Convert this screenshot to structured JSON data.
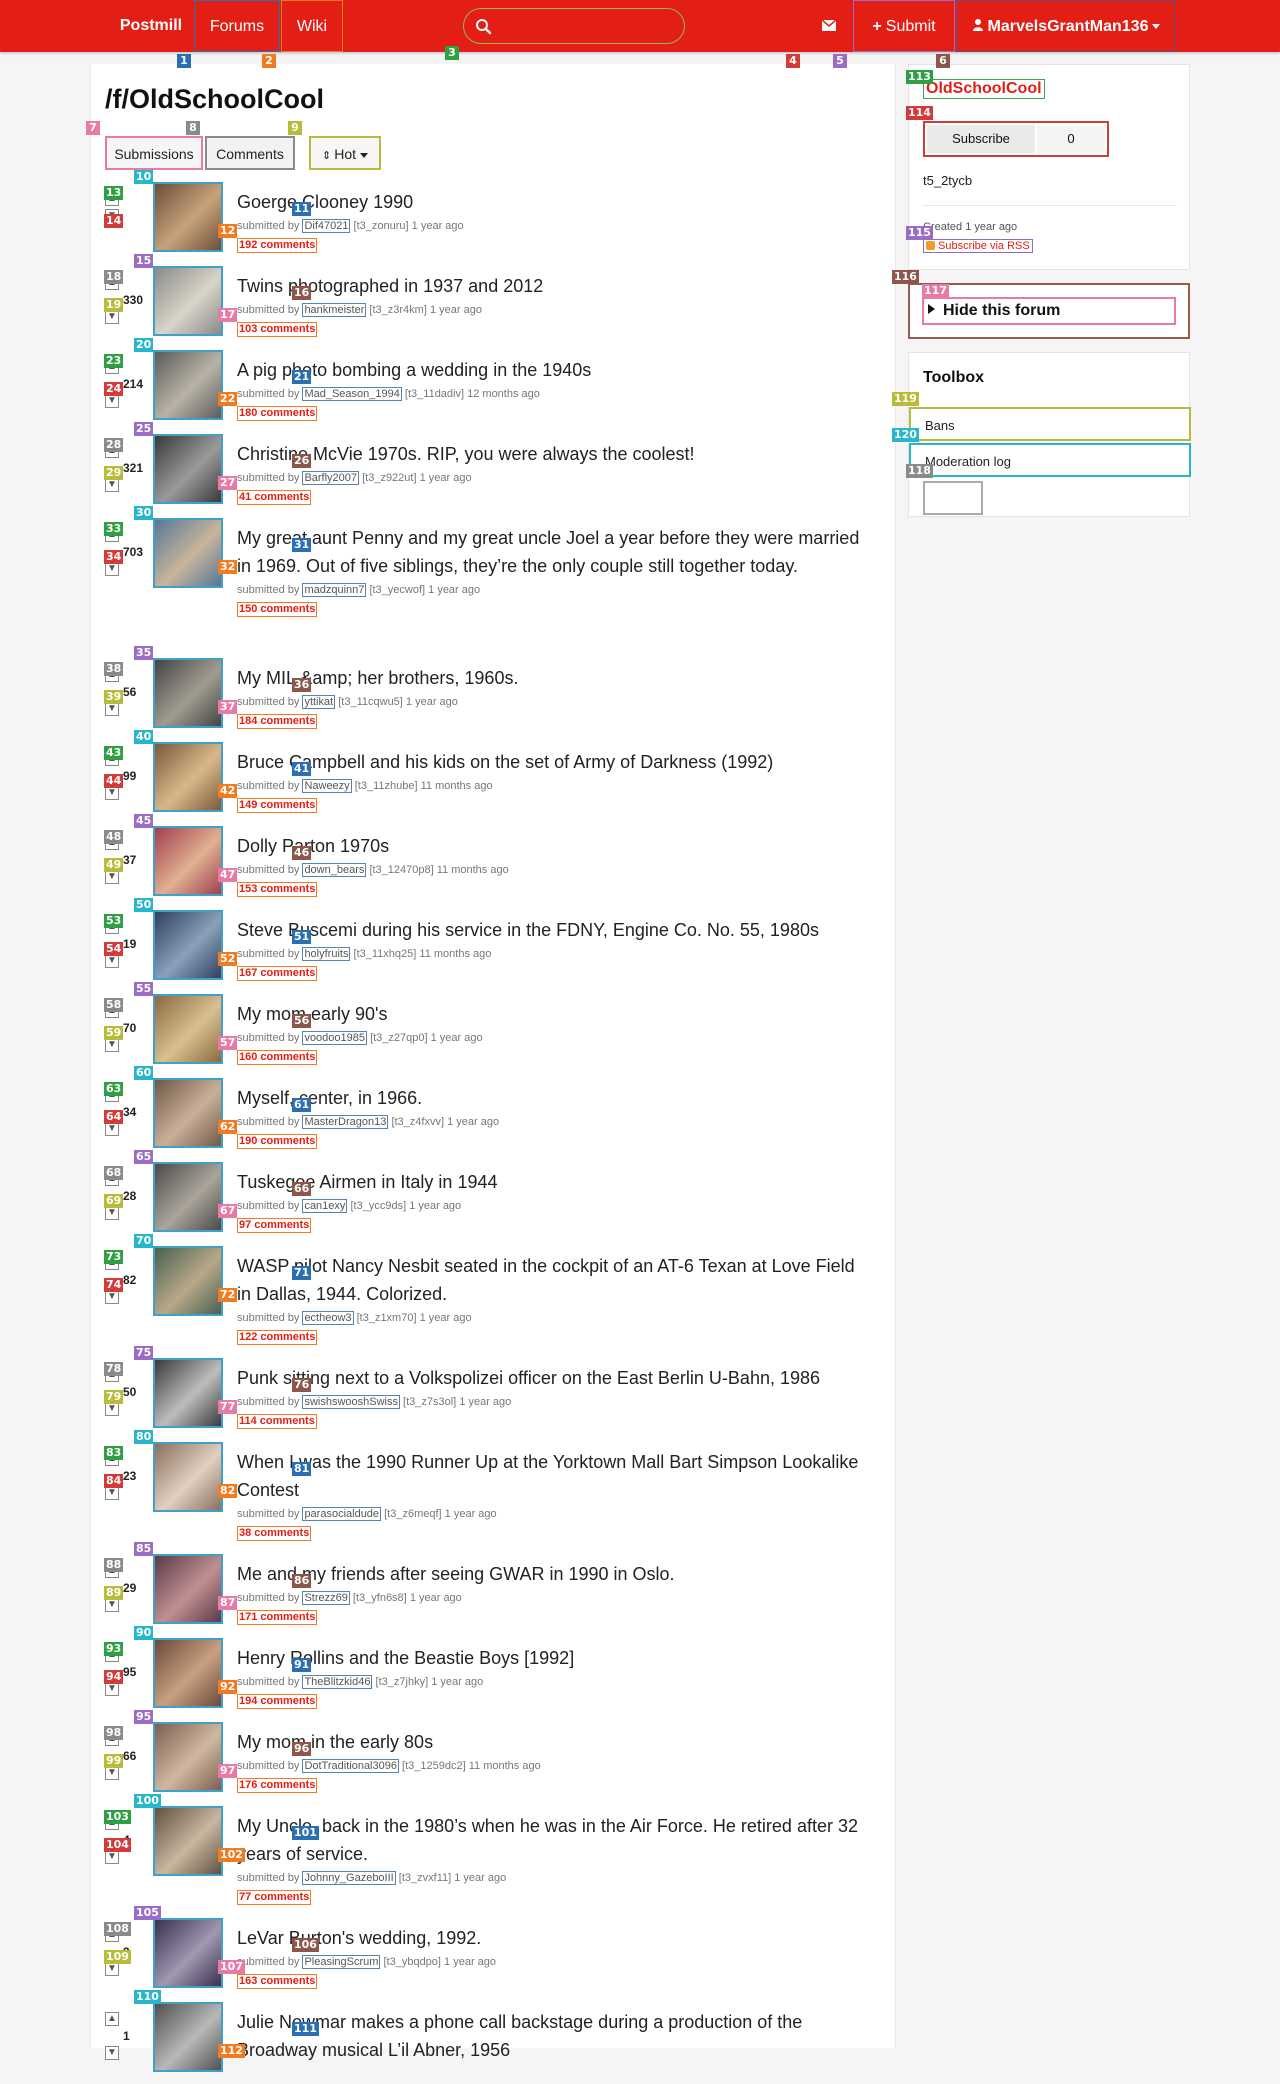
{
  "nav": {
    "brand": "Postmill",
    "forums": "Forums",
    "wiki": "Wiki",
    "submit": "Submit",
    "user": "MarvelsGrantMan136"
  },
  "search": {
    "placeholder": ""
  },
  "forum": {
    "title": "/f/OldSchoolCool",
    "tabs": [
      "Submissions",
      "Comments"
    ],
    "sort": "Hot"
  },
  "submissions": [
    {
      "score": "",
      "title": "Goerge Clooney 1990",
      "author": "Dif47021",
      "id": "[t3_zonuru]",
      "age": "1 year ago",
      "comments": "192 comments"
    },
    {
      "score": "330",
      "title": "Twins photographed in 1937 and 2012",
      "author": "hankmeister",
      "id": "[t3_z3r4km]",
      "age": "1 year ago",
      "comments": "103 comments"
    },
    {
      "score": "214",
      "title": "A pig photo bombing a wedding in the 1940s",
      "author": "Mad_Season_1994",
      "id": "[t3_11dadiv]",
      "age": "12 months ago",
      "comments": "180 comments"
    },
    {
      "score": "321",
      "title": "Christine McVie 1970s. RIP, you were always the coolest!",
      "author": "Barfly2007",
      "id": "[t3_z922ut]",
      "age": "1 year ago",
      "comments": "41 comments"
    },
    {
      "score": "703",
      "title": "My great aunt Penny and my great uncle Joel a year before they were married in 1969. Out of five siblings, they’re the only couple still together today.",
      "author": "madzquinn7",
      "id": "[t3_yecwof]",
      "age": "1 year ago",
      "comments": "150 comments"
    },
    {
      "score": "56",
      "title": "My MIL &amp; her brothers, 1960s.",
      "author": "yttikat",
      "id": "[t3_11cqwu5]",
      "age": "1 year ago",
      "comments": "184 comments"
    },
    {
      "score": "99",
      "title": "Bruce Campbell and his kids on the set of Army of Darkness (1992)",
      "author": "Naweezy",
      "id": "[t3_11zhube]",
      "age": "11 months ago",
      "comments": "149 comments"
    },
    {
      "score": "37",
      "title": "Dolly Parton 1970s",
      "author": "down_bears",
      "id": "[t3_12470p8]",
      "age": "11 months ago",
      "comments": "153 comments"
    },
    {
      "score": "19",
      "title": "Steve Buscemi during his service in the FDNY, Engine Co. No. 55, 1980s",
      "author": "holyfruits",
      "id": "[t3_11xhq25]",
      "age": "11 months ago",
      "comments": "167 comments"
    },
    {
      "score": "70",
      "title": "My mom early 90's",
      "author": "voodoo1985",
      "id": "[t3_z27qp0]",
      "age": "1 year ago",
      "comments": "160 comments"
    },
    {
      "score": "34",
      "title": "Myself, center, in 1966.",
      "author": "MasterDragon13",
      "id": "[t3_z4fxvv]",
      "age": "1 year ago",
      "comments": "190 comments"
    },
    {
      "score": "28",
      "title": "Tuskegee Airmen in Italy in 1944",
      "author": "can1exy",
      "id": "[t3_ycc9ds]",
      "age": "1 year ago",
      "comments": "97 comments"
    },
    {
      "score": "82",
      "title": "WASP pilot Nancy Nesbit seated in the cockpit of an AT-6 Texan at Love Field in Dallas, 1944. Colorized.",
      "author": "ectheow3",
      "id": "[t3_z1xm70]",
      "age": "1 year ago",
      "comments": "122 comments"
    },
    {
      "score": "50",
      "title": "Punk sitting next to a Volkspolizei officer on the East Berlin U-Bahn, 1986",
      "author": "swishswooshSwiss",
      "id": "[t3_z7s3ol]",
      "age": "1 year ago",
      "comments": "114 comments"
    },
    {
      "score": "23",
      "title": "When I was the 1990 Runner Up at the Yorktown Mall Bart Simpson Lookalike Contest",
      "author": "parasocialdude",
      "id": "[t3_z6meqf]",
      "age": "1 year ago",
      "comments": "38 comments"
    },
    {
      "score": "29",
      "title": "Me and my friends after seeing GWAR in 1990 in Oslo.",
      "author": "Strezz69",
      "id": "[t3_yfn6s8]",
      "age": "1 year ago",
      "comments": "171 comments"
    },
    {
      "score": "95",
      "title": "Henry Rollins and the Beastie Boys [1992]",
      "author": "TheBlitzkid46",
      "id": "[t3_z7jhky]",
      "age": "1 year ago",
      "comments": "194 comments"
    },
    {
      "score": "66",
      "title": "My mom in the early 80s",
      "author": "DotTraditional3096",
      "id": "[t3_1259dc2]",
      "age": "11 months ago",
      "comments": "176 comments"
    },
    {
      "score": "4",
      "title": "My Uncle, back in the 1980’s when he was in the Air Force. He retired after 32 years of service.",
      "author": "Johnny_GazeboIII",
      "id": "[t3_zvxf11]",
      "age": "1 year ago",
      "comments": "77 comments"
    },
    {
      "score": "3",
      "title": "LeVar Burton's wedding, 1992.",
      "author": "PleasingScrum",
      "id": "[t3_ybqdpo]",
      "age": "1 year ago",
      "comments": "163 comments"
    },
    {
      "score": "1",
      "title": "Julie Newmar makes a phone call backstage during a production of the Broadway musical L’il Abner, 1956",
      "author": "",
      "id": "",
      "age": "",
      "comments": ""
    }
  ],
  "meta_labels": {
    "submitted_by": "submitted by"
  },
  "sidebar": {
    "forum_name": "OldSchoolCool",
    "subscribe": "Subscribe",
    "subscriber_count": "0",
    "forum_id": "t5_2tycb",
    "created": "Created 1 year ago",
    "rss": "Subscribe via RSS",
    "hide_forum": "Hide this forum",
    "toolbox_title": "Toolbox",
    "toolbox_items": [
      "Bans",
      "Moderation log"
    ]
  },
  "colors": {
    "brand_red": "#e31e15",
    "nav_text": "#ffffff"
  },
  "icons": {
    "search": "search-icon",
    "mail": "envelope-icon",
    "submit": "plus-icon",
    "user": "user-icon",
    "sort": "sort-icon",
    "rss": "rss-icon"
  },
  "markers": [
    {
      "n": "1",
      "c": "#2a6fb0"
    },
    {
      "n": "2",
      "c": "#f27a1f"
    },
    {
      "n": "3",
      "c": "#2ea043"
    },
    {
      "n": "4",
      "c": "#d33a3a"
    },
    {
      "n": "5",
      "c": "#9b6cc4"
    },
    {
      "n": "6",
      "c": "#8c564b"
    },
    {
      "n": "7",
      "c": "#e87aa8"
    },
    {
      "n": "8",
      "c": "#8a8a8a"
    },
    {
      "n": "9",
      "c": "#b8bc3a"
    },
    {
      "n": "10",
      "c": "#2ab6c9"
    },
    {
      "n": "11",
      "c": "#2a6fb0"
    },
    {
      "n": "12",
      "c": "#f27a1f"
    },
    {
      "n": "13",
      "c": "#2ea043"
    },
    {
      "n": "14",
      "c": "#d33a3a"
    },
    {
      "n": "15",
      "c": "#9b6cc4"
    },
    {
      "n": "16",
      "c": "#8c564b"
    },
    {
      "n": "17",
      "c": "#e87aa8"
    },
    {
      "n": "18",
      "c": "#8a8a8a"
    },
    {
      "n": "19",
      "c": "#b8bc3a"
    },
    {
      "n": "20",
      "c": "#2ab6c9"
    },
    {
      "n": "21",
      "c": "#2a6fb0"
    },
    {
      "n": "22",
      "c": "#f27a1f"
    },
    {
      "n": "23",
      "c": "#2ea043"
    },
    {
      "n": "24",
      "c": "#d33a3a"
    },
    {
      "n": "25",
      "c": "#9b6cc4"
    },
    {
      "n": "26",
      "c": "#8c564b"
    },
    {
      "n": "27",
      "c": "#e87aa8"
    },
    {
      "n": "28",
      "c": "#8a8a8a"
    },
    {
      "n": "29",
      "c": "#b8bc3a"
    },
    {
      "n": "30",
      "c": "#2ab6c9"
    },
    {
      "n": "31",
      "c": "#2a6fb0"
    },
    {
      "n": "32",
      "c": "#f27a1f"
    },
    {
      "n": "33",
      "c": "#2ea043"
    },
    {
      "n": "34",
      "c": "#d33a3a"
    },
    {
      "n": "35",
      "c": "#9b6cc4"
    },
    {
      "n": "36",
      "c": "#8c564b"
    },
    {
      "n": "37",
      "c": "#e87aa8"
    },
    {
      "n": "38",
      "c": "#8a8a8a"
    },
    {
      "n": "39",
      "c": "#b8bc3a"
    },
    {
      "n": "40",
      "c": "#2ab6c9"
    },
    {
      "n": "41",
      "c": "#2a6fb0"
    },
    {
      "n": "42",
      "c": "#f27a1f"
    },
    {
      "n": "43",
      "c": "#2ea043"
    },
    {
      "n": "44",
      "c": "#d33a3a"
    },
    {
      "n": "45",
      "c": "#9b6cc4"
    },
    {
      "n": "46",
      "c": "#8c564b"
    },
    {
      "n": "47",
      "c": "#e87aa8"
    },
    {
      "n": "48",
      "c": "#8a8a8a"
    },
    {
      "n": "49",
      "c": "#b8bc3a"
    },
    {
      "n": "50",
      "c": "#2ab6c9"
    },
    {
      "n": "51",
      "c": "#2a6fb0"
    },
    {
      "n": "52",
      "c": "#f27a1f"
    },
    {
      "n": "53",
      "c": "#2ea043"
    },
    {
      "n": "54",
      "c": "#d33a3a"
    },
    {
      "n": "55",
      "c": "#9b6cc4"
    },
    {
      "n": "56",
      "c": "#8c564b"
    },
    {
      "n": "57",
      "c": "#e87aa8"
    },
    {
      "n": "58",
      "c": "#8a8a8a"
    },
    {
      "n": "59",
      "c": "#b8bc3a"
    },
    {
      "n": "60",
      "c": "#2ab6c9"
    },
    {
      "n": "61",
      "c": "#2a6fb0"
    },
    {
      "n": "62",
      "c": "#f27a1f"
    },
    {
      "n": "63",
      "c": "#2ea043"
    },
    {
      "n": "64",
      "c": "#d33a3a"
    },
    {
      "n": "65",
      "c": "#9b6cc4"
    },
    {
      "n": "66",
      "c": "#8c564b"
    },
    {
      "n": "67",
      "c": "#e87aa8"
    },
    {
      "n": "68",
      "c": "#8a8a8a"
    },
    {
      "n": "69",
      "c": "#b8bc3a"
    },
    {
      "n": "70",
      "c": "#2ab6c9"
    },
    {
      "n": "71",
      "c": "#2a6fb0"
    },
    {
      "n": "72",
      "c": "#f27a1f"
    },
    {
      "n": "73",
      "c": "#2ea043"
    },
    {
      "n": "74",
      "c": "#d33a3a"
    },
    {
      "n": "75",
      "c": "#9b6cc4"
    },
    {
      "n": "76",
      "c": "#8c564b"
    },
    {
      "n": "77",
      "c": "#e87aa8"
    },
    {
      "n": "78",
      "c": "#8a8a8a"
    },
    {
      "n": "79",
      "c": "#b8bc3a"
    },
    {
      "n": "80",
      "c": "#2ab6c9"
    },
    {
      "n": "81",
      "c": "#2a6fb0"
    },
    {
      "n": "82",
      "c": "#f27a1f"
    },
    {
      "n": "83",
      "c": "#2ea043"
    },
    {
      "n": "84",
      "c": "#d33a3a"
    },
    {
      "n": "85",
      "c": "#9b6cc4"
    },
    {
      "n": "86",
      "c": "#8c564b"
    },
    {
      "n": "87",
      "c": "#e87aa8"
    },
    {
      "n": "88",
      "c": "#8a8a8a"
    },
    {
      "n": "89",
      "c": "#b8bc3a"
    },
    {
      "n": "90",
      "c": "#2ab6c9"
    },
    {
      "n": "91",
      "c": "#2a6fb0"
    },
    {
      "n": "92",
      "c": "#f27a1f"
    },
    {
      "n": "93",
      "c": "#2ea043"
    },
    {
      "n": "94",
      "c": "#d33a3a"
    },
    {
      "n": "95",
      "c": "#9b6cc4"
    },
    {
      "n": "96",
      "c": "#8c564b"
    },
    {
      "n": "97",
      "c": "#e87aa8"
    },
    {
      "n": "98",
      "c": "#8a8a8a"
    },
    {
      "n": "99",
      "c": "#b8bc3a"
    },
    {
      "n": "100",
      "c": "#2ab6c9"
    },
    {
      "n": "101",
      "c": "#2a6fb0"
    },
    {
      "n": "102",
      "c": "#f27a1f"
    },
    {
      "n": "103",
      "c": "#2ea043"
    },
    {
      "n": "104",
      "c": "#d33a3a"
    },
    {
      "n": "105",
      "c": "#9b6cc4"
    },
    {
      "n": "106",
      "c": "#8c564b"
    },
    {
      "n": "107",
      "c": "#e87aa8"
    },
    {
      "n": "108",
      "c": "#8a8a8a"
    },
    {
      "n": "109",
      "c": "#b8bc3a"
    },
    {
      "n": "110",
      "c": "#2ab6c9"
    },
    {
      "n": "111",
      "c": "#2a6fb0"
    },
    {
      "n": "112",
      "c": "#f27a1f"
    },
    {
      "n": "113",
      "c": "#2ea043"
    },
    {
      "n": "114",
      "c": "#d33a3a"
    },
    {
      "n": "115",
      "c": "#9b6cc4"
    },
    {
      "n": "116",
      "c": "#8c564b"
    },
    {
      "n": "117",
      "c": "#e87aa8"
    },
    {
      "n": "118",
      "c": "#8a8a8a"
    },
    {
      "n": "119",
      "c": "#b8bc3a"
    },
    {
      "n": "120",
      "c": "#2ab6c9"
    }
  ]
}
